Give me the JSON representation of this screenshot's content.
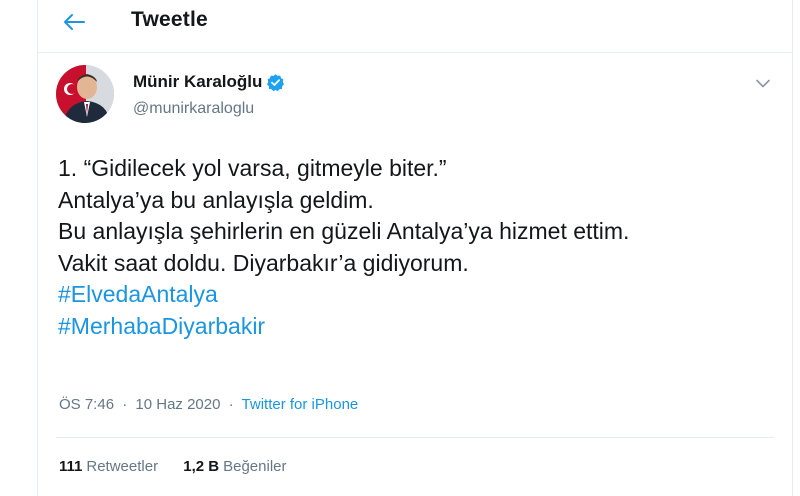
{
  "header": {
    "title": "Tweetle",
    "back_icon": "arrow-left-icon"
  },
  "author": {
    "name": "Münir Karaloğlu",
    "handle": "@munirkaraloglu",
    "verified_icon": "verified-badge-icon"
  },
  "tweet": {
    "lines": [
      "1. “Gidilecek yol varsa, gitmeyle biter.”",
      "Antalya’ya bu anlayışla geldim.",
      "Bu anlayışla şehirlerin en güzeli Antalya’ya hizmet ettim.",
      "Vakit saat doldu. Diyarbakır’a gidiyorum."
    ],
    "hashtags": [
      "#ElvedaAntalya",
      "#MerhabaDiyarbakir"
    ]
  },
  "meta": {
    "time": "ÖS 7:46",
    "separator1": "·",
    "date": "10 Haz 2020",
    "separator2": "·",
    "source": "Twitter for iPhone"
  },
  "stats": {
    "retweets_count": "111",
    "retweets_label": "Retweetler",
    "likes_count": "1,2 B",
    "likes_label": "Beğeniler"
  },
  "colors": {
    "accent": "#1b95e0",
    "text": "#14171a",
    "muted": "#657786",
    "border": "#e6ecf0"
  }
}
